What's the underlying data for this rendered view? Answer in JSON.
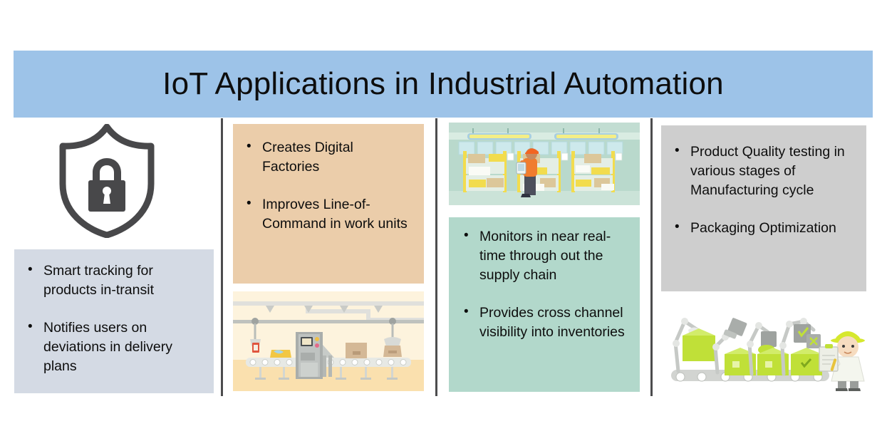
{
  "title": {
    "text": "IoT Applications in Industrial Automation",
    "banner_color": "#9DC3E8",
    "text_color": "#0D0D0D"
  },
  "divider_color": "#4C4C4E",
  "columns": [
    {
      "id": "tracking",
      "icon": "shield-lock-icon",
      "icon_color": "#48484A",
      "box_color": "#D4DAE4",
      "bullets": [
        "Smart tracking for products in-transit",
        "Notifies  users on deviations in delivery plans"
      ]
    },
    {
      "id": "digital-factory",
      "box_color": "#EBCDAA",
      "bullets": [
        "Creates   Digital Factories",
        "Improves Line-of-Command in work units"
      ],
      "image": {
        "name": "conveyor-belt-illustration",
        "background": "#FAE7BE"
      }
    },
    {
      "id": "supply-chain",
      "box_color": "#B2D8CB",
      "bullets": [
        "Monitors in near real-time through out the supply chain",
        "Provides cross channel visibility into inventories"
      ],
      "image": {
        "name": "warehouse-worker-illustration",
        "background": "#CFE6DC"
      }
    },
    {
      "id": "quality",
      "box_color": "#CECECE",
      "bullets": [
        "Product Quality testing in various stages of Manufacturing cycle",
        "Packaging Optimization"
      ],
      "image": {
        "name": "robotic-arms-inspection-illustration",
        "background": "#FFFFFF"
      }
    }
  ]
}
